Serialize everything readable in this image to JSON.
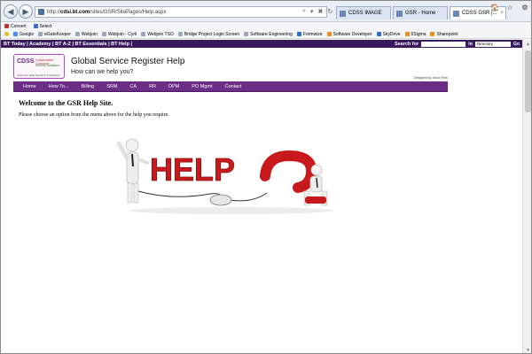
{
  "browser": {
    "url_prefix": "http://",
    "url_host": "cdsi.bt.com",
    "url_path": "/sites/GSR/SitePages/Help.aspx",
    "address_actions": [
      "⌕",
      "▾",
      "✖",
      "↻"
    ],
    "tabs": [
      {
        "label": "CDSS IMAGE",
        "active": false
      },
      {
        "label": "GSR - Home",
        "active": false
      },
      {
        "label": "CDSS GSR |...",
        "active": true
      }
    ],
    "tab_close": "×",
    "window_controls": [
      "🏠",
      "☆",
      "⚙"
    ]
  },
  "command_bar": {
    "items": [
      "Convert",
      "Select"
    ]
  },
  "favorites": [
    "Google",
    "eGateKeeper",
    "Webjoin",
    "Webjoin - Cyril",
    "Webjoin TSO",
    "Bridge Project Login Screen",
    "Software Engineering",
    "Formwize",
    "Software Developer",
    "SkyDrive",
    "6Sigma",
    "Sharepoint"
  ],
  "bt_bar": {
    "links": "BT Today | Academy | BT A-Z | BT Essentials | BT Help |",
    "search_label": "Search for",
    "in_label": "in",
    "select_value": "Directory",
    "go_label": "Go"
  },
  "header": {
    "logo_text": "CDSS",
    "logo_line1": "Collaborative Customer",
    "logo_line2": "Service Solutions",
    "logo_tag": "Customer Data Systems & Solutions",
    "title": "Global Service Register Help",
    "subtitle": "How can we help you?",
    "designed_by": "Designed by Jason Park"
  },
  "menu": [
    "Home",
    "How To...",
    "Billing",
    "SRM",
    "CA",
    "RR",
    "DPM",
    "PO Mgmt",
    "Contact"
  ],
  "main": {
    "heading": "Welcome to the GSR Help Site.",
    "intro": "Please choose an option from the menu above for the help you require.",
    "art_text": "HELP"
  },
  "scrollbar": {
    "up": "▲",
    "down": "▼"
  },
  "colors": {
    "bt_bar": "#3a1a5c",
    "menu": "#6b2d86",
    "help_red": "#c8191c"
  }
}
